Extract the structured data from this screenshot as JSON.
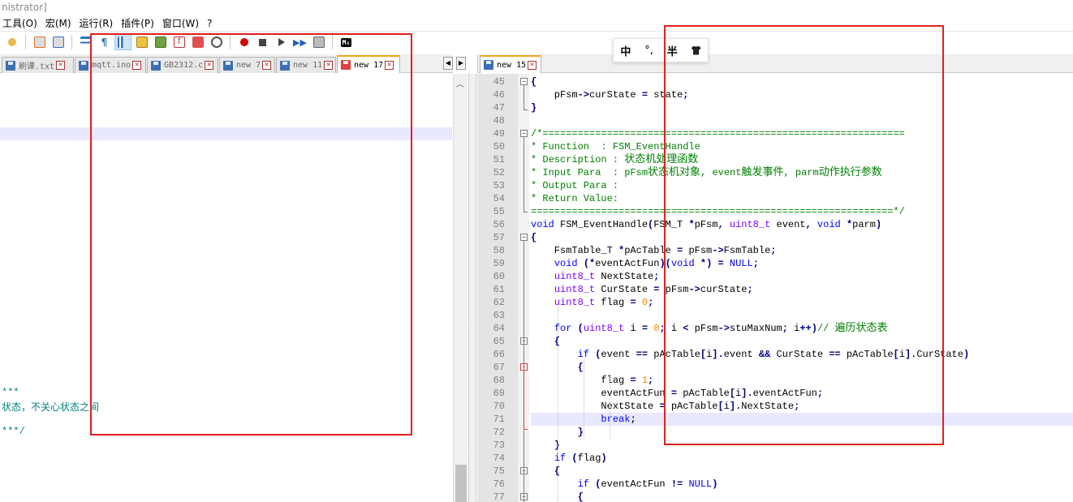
{
  "window": {
    "title_fragment": "nistrator]"
  },
  "menu": [
    "工具(O)",
    "宏(M)",
    "运行(R)",
    "插件(P)",
    "窗口(W)",
    "?"
  ],
  "left_tabs": [
    {
      "label": "刷课.txt",
      "color": "blue"
    },
    {
      "label": "mqtt.ino",
      "color": "blue"
    },
    {
      "label": "GB2312.c",
      "color": "blue"
    },
    {
      "label": "new 7",
      "color": "blue"
    },
    {
      "label": "new 11",
      "color": "blue"
    },
    {
      "label": "new 17",
      "color": "red",
      "active": true
    }
  ],
  "right_tabs": [
    {
      "label": "new 15",
      "color": "blue",
      "active": true
    }
  ],
  "ime": {
    "mode": "中",
    "punct": "°,",
    "width": "半"
  },
  "left_visible_text": [
    {
      "text": "***"
    },
    {
      "text": "状态，不关心状态之间"
    },
    {
      "text": "***/"
    }
  ],
  "code_lines": [
    {
      "n": "45",
      "t": "{"
    },
    {
      "n": "46",
      "t": "    pFsm->curState = state;"
    },
    {
      "n": "47",
      "t": "}"
    },
    {
      "n": "48",
      "t": ""
    },
    {
      "n": "49",
      "t": "/*=============================================================="
    },
    {
      "n": "50",
      "t": "* Function  : FSM_EventHandle"
    },
    {
      "n": "51",
      "t": "* Description : 状态机处理函数"
    },
    {
      "n": "52",
      "t": "* Input Para  : pFsm状态机对象, event触发事件, parm动作执行参数"
    },
    {
      "n": "53",
      "t": "* Output Para :"
    },
    {
      "n": "54",
      "t": "* Return Value:"
    },
    {
      "n": "55",
      "t": "==============================================================*/"
    },
    {
      "n": "56",
      "t": "void FSM_EventHandle(FSM_T *pFsm, uint8_t event, void *parm)"
    },
    {
      "n": "57",
      "t": "{"
    },
    {
      "n": "58",
      "t": "    FsmTable_T *pAcTable = pFsm->FsmTable;"
    },
    {
      "n": "59",
      "t": "    void (*eventActFun)(void *) = NULL;"
    },
    {
      "n": "60",
      "t": "    uint8_t NextState;"
    },
    {
      "n": "61",
      "t": "    uint8_t CurState = pFsm->curState;"
    },
    {
      "n": "62",
      "t": "    uint8_t flag = 0;"
    },
    {
      "n": "63",
      "t": ""
    },
    {
      "n": "64",
      "t": "    for (uint8_t i = 0; i < pFsm->stuMaxNum; i++)// 遍历状态表"
    },
    {
      "n": "65",
      "t": "    {"
    },
    {
      "n": "66",
      "t": "        if (event == pAcTable[i].event && CurState == pAcTable[i].CurState)"
    },
    {
      "n": "67",
      "t": "        {"
    },
    {
      "n": "68",
      "t": "            flag = 1;"
    },
    {
      "n": "69",
      "t": "            eventActFun = pAcTable[i].eventActFun;"
    },
    {
      "n": "70",
      "t": "            NextState = pAcTable[i].NextState;"
    },
    {
      "n": "71",
      "t": "            break;"
    },
    {
      "n": "72",
      "t": "        }"
    },
    {
      "n": "73",
      "t": "    }"
    },
    {
      "n": "74",
      "t": "    if (flag)"
    },
    {
      "n": "75",
      "t": "    {"
    },
    {
      "n": "76",
      "t": "        if (eventActFun != NULL)"
    },
    {
      "n": "77",
      "t": "        {"
    }
  ],
  "colors": {
    "annotation_box": "#e02020",
    "line_highlight": "#e8e8ff",
    "keyword": "#0000ff",
    "type": "#8000ff",
    "number": "#ff8000",
    "comment": "#008000"
  }
}
